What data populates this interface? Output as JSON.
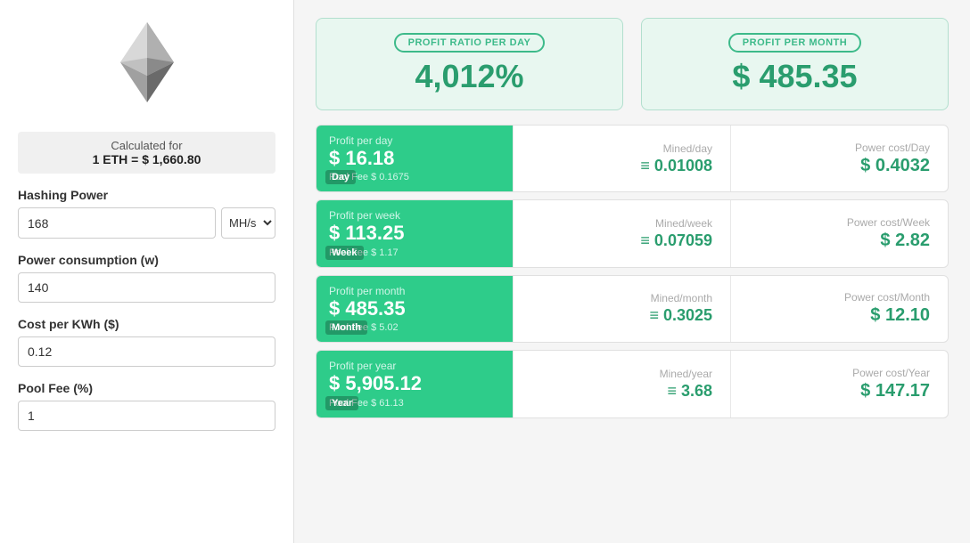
{
  "left": {
    "calculated_label": "Calculated for",
    "eth_price": "1 ETH = $ 1,660.80",
    "hashing_power_label": "Hashing Power",
    "hashing_power_value": "168",
    "hashing_unit": "MH/s",
    "power_consumption_label": "Power consumption (w)",
    "power_consumption_value": "140",
    "cost_per_kwh_label": "Cost per KWh ($)",
    "cost_per_kwh_value": "0.12",
    "pool_fee_label": "Pool Fee (%)",
    "pool_fee_value": "1"
  },
  "summary": {
    "ratio_label": "PROFIT RATIO PER DAY",
    "ratio_value": "4,012%",
    "monthly_label": "PROFIT PER MONTH",
    "monthly_value": "$ 485.35"
  },
  "rows": [
    {
      "id": "day",
      "tag": "Day",
      "profit_label": "Profit per day",
      "profit_value": "$ 16.18",
      "pool_fee": "Pool Fee $ 0.1675",
      "mined_label": "Mined/day",
      "mined_value": "≡ 0.01008",
      "power_label": "Power cost/Day",
      "power_value": "$ 0.4032"
    },
    {
      "id": "week",
      "tag": "Week",
      "profit_label": "Profit per week",
      "profit_value": "$ 113.25",
      "pool_fee": "Pool Fee $ 1.17",
      "mined_label": "Mined/week",
      "mined_value": "≡ 0.07059",
      "power_label": "Power cost/Week",
      "power_value": "$ 2.82"
    },
    {
      "id": "month",
      "tag": "Month",
      "profit_label": "Profit per month",
      "profit_value": "$ 485.35",
      "pool_fee": "Pool Fee $ 5.02",
      "mined_label": "Mined/month",
      "mined_value": "≡ 0.3025",
      "power_label": "Power cost/Month",
      "power_value": "$ 12.10"
    },
    {
      "id": "year",
      "tag": "Year",
      "profit_label": "Profit per year",
      "profit_value": "$ 5,905.12",
      "pool_fee": "Pool Fee $ 61.13",
      "mined_label": "Mined/year",
      "mined_value": "≡ 3.68",
      "power_label": "Power cost/Year",
      "power_value": "$ 147.17"
    }
  ]
}
